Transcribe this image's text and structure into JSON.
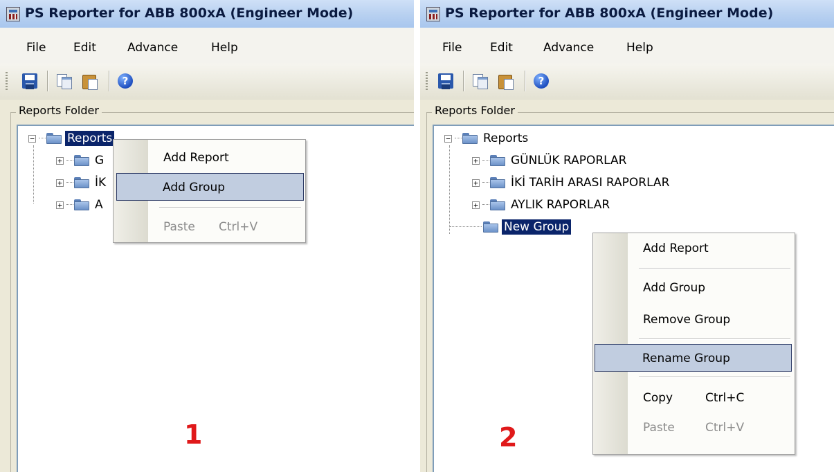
{
  "window": {
    "title": "PS Reporter for ABB 800xA (Engineer Mode)"
  },
  "menu": [
    "File",
    "Edit",
    "Advance",
    "Help"
  ],
  "toolbar": {
    "icons": [
      "save-icon",
      "copy-icon",
      "paste-icon",
      "help-icon"
    ],
    "help_glyph": "?"
  },
  "group_label": "Reports Folder",
  "panel1": {
    "step": "1",
    "tree": {
      "root": "Reports",
      "children_visible": [
        "G",
        "İK",
        "A"
      ]
    },
    "context_menu": [
      {
        "label": "Add Report",
        "shortcut": "",
        "state": "normal"
      },
      {
        "label": "Add Group",
        "shortcut": "",
        "state": "highlighted"
      },
      {
        "label": "Paste",
        "shortcut": "Ctrl+V",
        "state": "disabled"
      }
    ]
  },
  "panel2": {
    "step": "2",
    "tree": {
      "root": "Reports",
      "children": [
        "GÜNLÜK RAPORLAR",
        "İKİ TARİH ARASI RAPORLAR",
        "AYLIK RAPORLAR",
        "New Group"
      ]
    },
    "context_menu": [
      {
        "label": "Add Report",
        "shortcut": "",
        "state": "normal"
      },
      {
        "label": "Add Group",
        "shortcut": "",
        "state": "normal"
      },
      {
        "label": "Remove Group",
        "shortcut": "",
        "state": "normal"
      },
      {
        "label": "Rename Group",
        "shortcut": "",
        "state": "highlighted"
      },
      {
        "label": "Copy",
        "shortcut": "Ctrl+C",
        "state": "normal"
      },
      {
        "label": "Paste",
        "shortcut": "Ctrl+V",
        "state": "disabled"
      }
    ]
  }
}
